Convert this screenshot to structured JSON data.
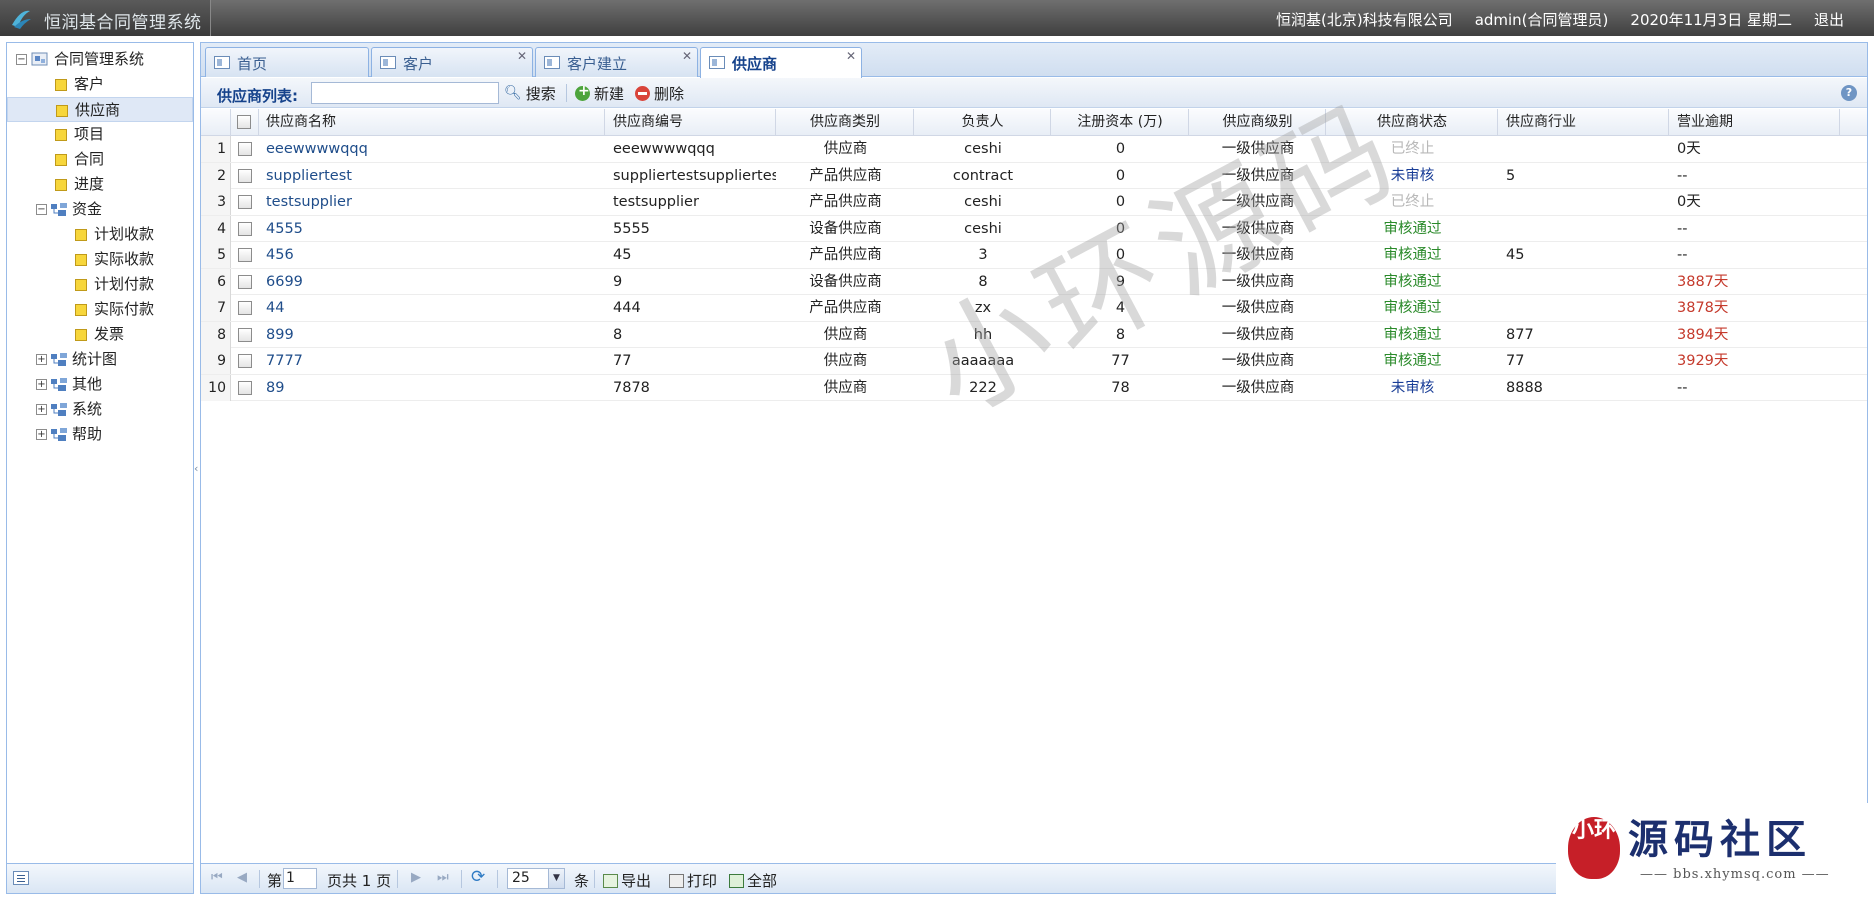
{
  "header": {
    "app_title": "恒润基合同管理系统",
    "company": "恒润基(北京)科技有限公司",
    "user": "admin(合同管理员)",
    "date": "2020年11月3日 星期二",
    "logout": "退出"
  },
  "sidebar": {
    "root": "合同管理系统",
    "items": [
      {
        "label": "客户",
        "level": 1,
        "type": "page"
      },
      {
        "label": "供应商",
        "level": 1,
        "type": "page",
        "selected": true
      },
      {
        "label": "项目",
        "level": 1,
        "type": "page"
      },
      {
        "label": "合同",
        "level": 1,
        "type": "page"
      },
      {
        "label": "进度",
        "level": 1,
        "type": "page"
      },
      {
        "label": "资金",
        "level": 1,
        "type": "folder",
        "expanded": true
      },
      {
        "label": "计划收款",
        "level": 2,
        "type": "page"
      },
      {
        "label": "实际收款",
        "level": 2,
        "type": "page"
      },
      {
        "label": "计划付款",
        "level": 2,
        "type": "page"
      },
      {
        "label": "实际付款",
        "level": 2,
        "type": "page"
      },
      {
        "label": "发票",
        "level": 2,
        "type": "page"
      },
      {
        "label": "统计图",
        "level": 1,
        "type": "folder",
        "expanded": false
      },
      {
        "label": "其他",
        "level": 1,
        "type": "folder",
        "expanded": false
      },
      {
        "label": "系统",
        "level": 1,
        "type": "folder",
        "expanded": false
      },
      {
        "label": "帮助",
        "level": 1,
        "type": "folder",
        "expanded": false
      }
    ]
  },
  "tabs": [
    {
      "label": "首页",
      "closable": false
    },
    {
      "label": "客户",
      "closable": true
    },
    {
      "label": "客户建立",
      "closable": true
    },
    {
      "label": "供应商",
      "closable": true,
      "active": true
    }
  ],
  "toolbar": {
    "list_label": "供应商列表:",
    "search_value": "",
    "search": "搜索",
    "new": "新建",
    "delete": "删除"
  },
  "grid": {
    "columns": [
      "供应商名称",
      "供应商编号",
      "供应商类别",
      "负责人",
      "注册资本 (万)",
      "供应商级别",
      "供应商状态",
      "供应商行业",
      "营业逾期"
    ],
    "rows": [
      {
        "num": "1",
        "name": "eeewwwwqqq",
        "code": "eeewwwwqqq",
        "category": "供应商",
        "owner": "ceshi",
        "capital": "0",
        "level": "一级供应商",
        "status": "已终止",
        "status_type": "ended",
        "industry": "",
        "overdue": "0天",
        "overdue_type": "normal"
      },
      {
        "num": "2",
        "name": "suppliertest",
        "code": "suppliertestsuppliertest",
        "category": "产品供应商",
        "owner": "contract",
        "capital": "0",
        "level": "一级供应商",
        "status": "未审核",
        "status_type": "pending",
        "industry": "5",
        "overdue": "--",
        "overdue_type": "normal"
      },
      {
        "num": "3",
        "name": "testsupplier",
        "code": "testsupplier",
        "category": "产品供应商",
        "owner": "ceshi",
        "capital": "0",
        "level": "一级供应商",
        "status": "已终止",
        "status_type": "ended",
        "industry": "",
        "overdue": "0天",
        "overdue_type": "normal"
      },
      {
        "num": "4",
        "name": "4555",
        "code": "5555",
        "category": "设备供应商",
        "owner": "ceshi",
        "capital": "0",
        "level": "一级供应商",
        "status": "审核通过",
        "status_type": "passed",
        "industry": "",
        "overdue": "--",
        "overdue_type": "normal"
      },
      {
        "num": "5",
        "name": "456",
        "code": "45",
        "category": "产品供应商",
        "owner": "3",
        "capital": "0",
        "level": "一级供应商",
        "status": "审核通过",
        "status_type": "passed",
        "industry": "45",
        "overdue": "--",
        "overdue_type": "normal"
      },
      {
        "num": "6",
        "name": "6699",
        "code": "9",
        "category": "设备供应商",
        "owner": "8",
        "capital": "9",
        "level": "一级供应商",
        "status": "审核通过",
        "status_type": "passed",
        "industry": "",
        "overdue": "3887天",
        "overdue_type": "late"
      },
      {
        "num": "7",
        "name": "44",
        "code": "444",
        "category": "产品供应商",
        "owner": "zx",
        "capital": "4",
        "level": "一级供应商",
        "status": "审核通过",
        "status_type": "passed",
        "industry": "",
        "overdue": "3878天",
        "overdue_type": "late"
      },
      {
        "num": "8",
        "name": "899",
        "code": "8",
        "category": "供应商",
        "owner": "hh",
        "capital": "8",
        "level": "一级供应商",
        "status": "审核通过",
        "status_type": "passed",
        "industry": "877",
        "overdue": "3894天",
        "overdue_type": "late"
      },
      {
        "num": "9",
        "name": "7777",
        "code": "77",
        "category": "供应商",
        "owner": "aaaaaaa",
        "capital": "77",
        "level": "一级供应商",
        "status": "审核通过",
        "status_type": "passed",
        "industry": "77",
        "overdue": "3929天",
        "overdue_type": "late"
      },
      {
        "num": "10",
        "name": "89",
        "code": "7878",
        "category": "供应商",
        "owner": "222",
        "capital": "78",
        "level": "一级供应商",
        "status": "未审核",
        "status_type": "pending",
        "industry": "8888",
        "overdue": "--",
        "overdue_type": "normal"
      }
    ]
  },
  "pager": {
    "page_prefix": "第",
    "page_value": "1",
    "page_suffix": "页共 1 页",
    "page_size": "25",
    "size_suffix": "条",
    "export": "导出",
    "print": "打印",
    "all": "全部"
  },
  "watermark": "小环源码",
  "badge": {
    "title": "源码社区",
    "url": "—— bbs.xhymsq.com ——",
    "seal": "小环"
  },
  "colors": {
    "status_ended": "#b9b9b9",
    "status_pending": "#1a3e97",
    "status_passed": "#2a8a2a",
    "overdue_late": "#c53a2c",
    "link": "#1f4d8a"
  }
}
